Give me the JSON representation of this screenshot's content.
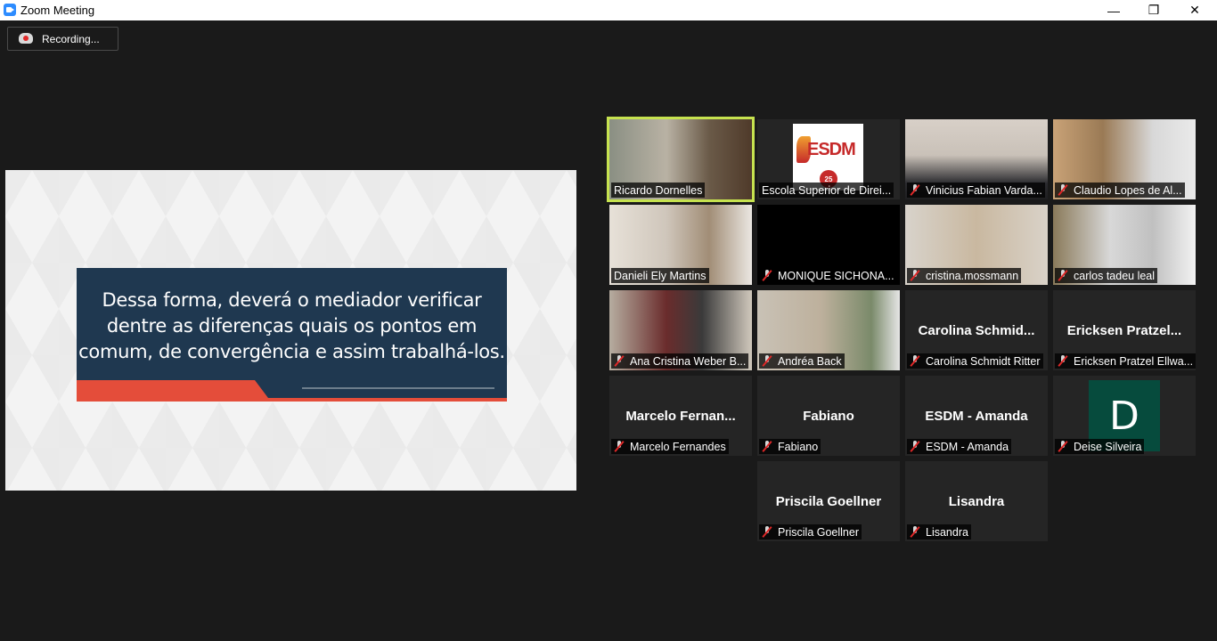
{
  "window": {
    "title": "Zoom Meeting",
    "minimize": "—",
    "restore": "❐",
    "close": "✕"
  },
  "recording": {
    "label": "Recording..."
  },
  "slide": {
    "lines": [
      "Dessa forma, deverá o mediador verificar",
      "dentre as diferenças quais os pontos em",
      "comum, de convergência e assim trabalhá-los."
    ]
  },
  "esdm_logo": {
    "text": "ESDM",
    "seal": "25"
  },
  "participants": [
    {
      "name": "Ricardo  Dornelles",
      "muted": false,
      "video": true,
      "speaking": true
    },
    {
      "name": "Escola Superior de Direi...",
      "muted": false,
      "video": "logo"
    },
    {
      "name": "Vinicius Fabian Varda...",
      "muted": true,
      "video": true
    },
    {
      "name": "Claudio Lopes de Al...",
      "muted": true,
      "video": true
    },
    {
      "name": "Danieli Ely Martins",
      "muted": false,
      "video": true
    },
    {
      "name": "MONIQUE SICHONA...",
      "muted": true,
      "video": "black"
    },
    {
      "name": "cristina.mossmann",
      "muted": true,
      "video": true
    },
    {
      "name": "carlos tadeu leal",
      "muted": true,
      "video": true
    },
    {
      "name": "Ana Cristina Weber B...",
      "muted": true,
      "video": true
    },
    {
      "name": "Andréa Back",
      "muted": true,
      "video": true
    },
    {
      "name": "Carolina Schmidt Ritter",
      "muted": true,
      "video": false,
      "display": "Carolina  Schmid..."
    },
    {
      "name": "Ericksen Pratzel Ellwa...",
      "muted": true,
      "video": false,
      "display": "Ericksen  Pratzel..."
    },
    {
      "name": "Marcelo Fernandes",
      "muted": true,
      "video": false,
      "display": "Marcelo  Fernan..."
    },
    {
      "name": "Fabiano",
      "muted": true,
      "video": false,
      "display": "Fabiano"
    },
    {
      "name": "ESDM - Amanda",
      "muted": true,
      "video": false,
      "display": "ESDM - Amanda"
    },
    {
      "name": "Deise Silveira",
      "muted": true,
      "video": "avatar",
      "avatar": "D",
      "avatar_color": "#064b3d"
    },
    {
      "name": "Priscila Goellner",
      "muted": true,
      "video": false,
      "display": "Priscila Goellner"
    },
    {
      "name": "Lisandra",
      "muted": true,
      "video": false,
      "display": "Lisandra"
    }
  ],
  "colors": {
    "speaking_border": "#c6e24f",
    "mute_red": "#e02828",
    "slide_bg": "#1f3850",
    "slide_accent": "#e44d3a"
  }
}
